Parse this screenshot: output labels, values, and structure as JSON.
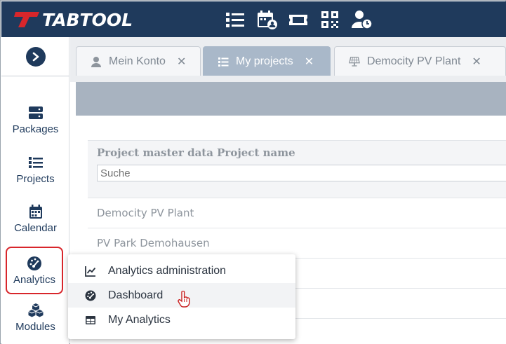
{
  "header": {
    "logo_text": "TABTOOL",
    "icons": [
      "list-icon",
      "calendar-user-icon",
      "ticket-icon",
      "qr-code-icon",
      "user-clock-icon"
    ]
  },
  "sidebar": {
    "toggle_icon": "chevron-right-icon",
    "items": [
      {
        "label": "Packages",
        "icon": "server-icon"
      },
      {
        "label": "Projects",
        "icon": "list-icon"
      },
      {
        "label": "Calendar",
        "icon": "calendar-icon"
      },
      {
        "label": "Analytics",
        "icon": "gauge-icon",
        "active": true
      },
      {
        "label": "Modules",
        "icon": "cubes-icon"
      }
    ]
  },
  "tabs": [
    {
      "label": "Mein Konto",
      "icon": "user-icon",
      "active": false
    },
    {
      "label": "My projects",
      "icon": "list-icon",
      "active": true
    },
    {
      "label": "Democity PV Plant",
      "icon": "solar-panel-icon",
      "active": false
    }
  ],
  "table": {
    "header": "Project master data Project name",
    "search_placeholder": "Suche",
    "rows": [
      "Democity PV Plant",
      "PV Park Demohausen"
    ]
  },
  "menu": {
    "items": [
      {
        "label": "Analytics administration",
        "icon": "chart-line-icon"
      },
      {
        "label": "Dashboard",
        "icon": "gauge-icon",
        "hover": true
      },
      {
        "label": "My Analytics",
        "icon": "table-icon"
      }
    ]
  },
  "colors": {
    "brand_navy": "#1f3a5c",
    "brand_red": "#d8262b",
    "tab_active": "#a9b8c9"
  }
}
